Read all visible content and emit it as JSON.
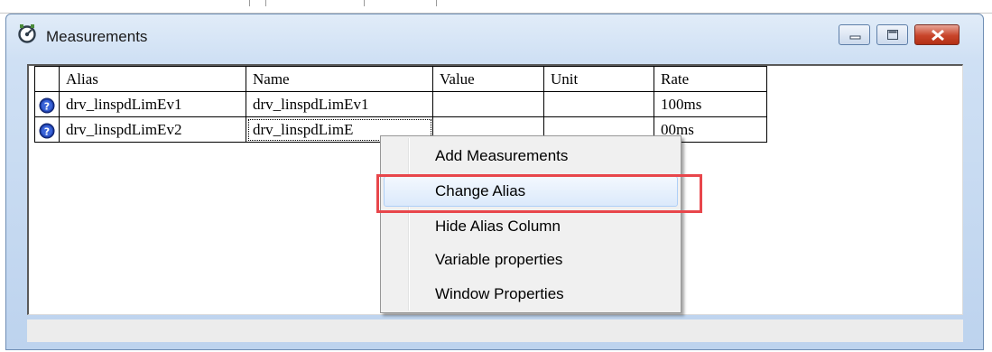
{
  "window": {
    "title": "Measurements",
    "icon": "gauge-icon",
    "controls": [
      "minimize-icon",
      "maximize-icon",
      "close-icon"
    ],
    "close_color": "#c8442a"
  },
  "table": {
    "columns": [
      "Alias",
      "Name",
      "Value",
      "Unit",
      "Rate"
    ],
    "rows": [
      {
        "icon": "info-icon",
        "alias": "drv_linspdLimEv1",
        "name": "drv_linspdLimEv1",
        "value": "",
        "unit": "",
        "rate": "100ms"
      },
      {
        "icon": "info-icon",
        "alias": "drv_linspdLimEv2",
        "name": "drv_linspdLimE",
        "value": "",
        "unit": "",
        "rate": "00ms"
      }
    ]
  },
  "context_menu": {
    "items": [
      "Add Measurements",
      "Change Alias",
      "Hide Alias Column",
      "Variable properties",
      "Window Properties"
    ],
    "hovered": "Change Alias",
    "highlight_color": "#e8464b"
  }
}
